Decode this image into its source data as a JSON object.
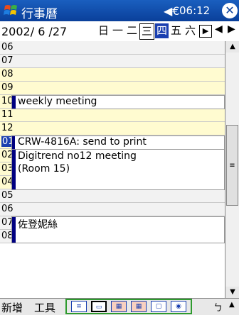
{
  "titlebar": {
    "title": "行事曆",
    "time": "06:12",
    "speaker": "◀€",
    "close": "✕"
  },
  "datebar": {
    "date": "2002/ 6 /27",
    "days": [
      "日",
      "一",
      "二",
      "三",
      "四",
      "五",
      "六"
    ],
    "selected_day_index": 3,
    "today_index": 4
  },
  "rows": [
    "06",
    "07",
    "08",
    "09",
    "10",
    "11",
    "12",
    "01",
    "02",
    "03",
    "04",
    "05",
    "06",
    "07",
    "08"
  ],
  "appointments": [
    {
      "text": "weekly meeting"
    },
    {
      "text": "CRW-4816A: send to print"
    },
    {
      "text": "Digitrend no12 meeting\n(Room 15)"
    },
    {
      "text": "佐登妮絲"
    }
  ],
  "bottombar": {
    "new_label": "新增",
    "tools_label": "工具",
    "sip_label": "ㄅ",
    "sip_arrow": "▲"
  },
  "view_buttons": [
    "agenda-view",
    "day-view",
    "week-view",
    "month-view",
    "year-view",
    "today"
  ]
}
